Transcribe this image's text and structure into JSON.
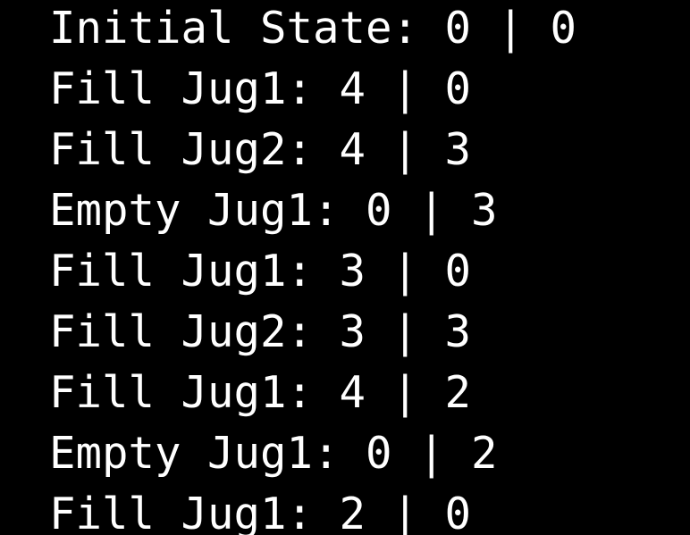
{
  "console": {
    "lines": [
      "Initial State: 0 | 0",
      "Fill Jug1: 4 | 0",
      "Fill Jug2: 4 | 3",
      "Empty Jug1: 0 | 3",
      "Fill Jug1: 3 | 0",
      "Fill Jug2: 3 | 3",
      "Fill Jug1: 4 | 2",
      "Empty Jug1: 0 | 2",
      "Fill Jug1: 2 | 0"
    ],
    "background_color": "#000000",
    "text_color": "#ffffff"
  }
}
